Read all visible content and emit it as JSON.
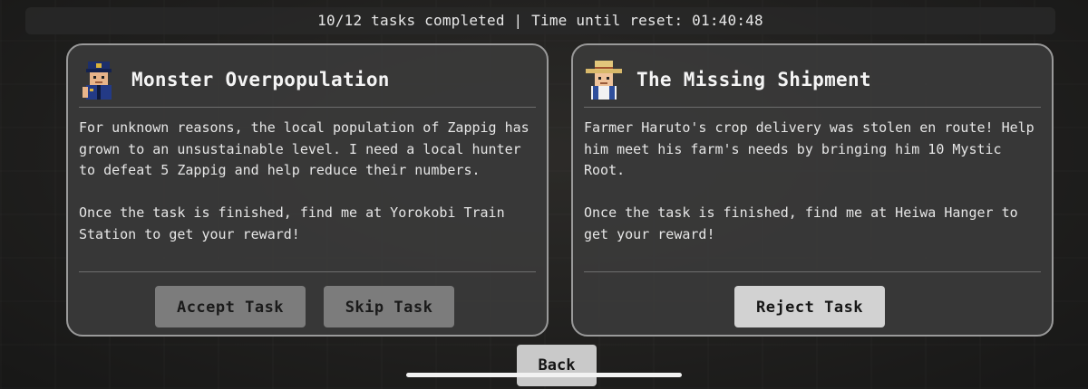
{
  "status": {
    "text": "10/12 tasks completed | Time until reset: 01:40:48"
  },
  "tasks": [
    {
      "title": "Monster Overpopulation",
      "avatar_icon": "police-officer-avatar-icon",
      "description": "For unknown reasons, the local population of Zappig has grown to an unsustainable level. I need a local hunter to defeat 5 Zappig and help reduce their numbers.",
      "location_note": "Once the task is finished, find me at Yorokobi Train Station to get your reward!",
      "accept_label": "Accept Task",
      "skip_label": "Skip Task"
    },
    {
      "title": "The Missing Shipment",
      "avatar_icon": "farmer-straw-hat-avatar-icon",
      "description": "Farmer Haruto's crop delivery was stolen en route! Help him meet his farm's needs by bringing him 10 Mystic Root.",
      "location_note": "Once the task is finished, find me at Heiwa Hanger to get your reward!",
      "reject_label": "Reject Task"
    }
  ],
  "back_label": "Back",
  "colors": {
    "card_bg": "#3a3a3a",
    "card_border": "#9a9a9a",
    "button_dim": "#7c7c7c",
    "button_active": "#d2d2d2"
  }
}
